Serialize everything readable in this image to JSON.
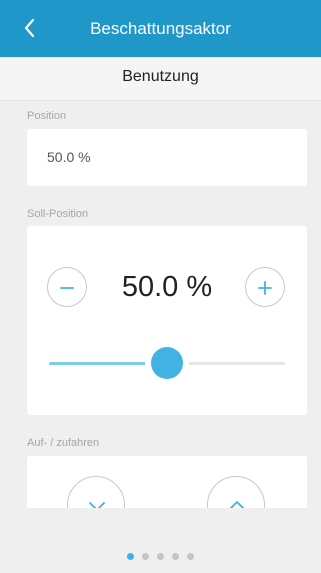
{
  "header": {
    "title": "Beschattungsaktor",
    "back_icon": "chevron-left-icon"
  },
  "subheader": {
    "title": "Benutzung"
  },
  "position": {
    "label": "Position",
    "value": "50.0 %"
  },
  "soll_position": {
    "label": "Soll-Position",
    "value": "50.0 %",
    "slider_level": 0.5,
    "minus_icon": "minus-icon",
    "plus_icon": "plus-icon"
  },
  "auf_zufahren": {
    "label": "Auf- / zufahren",
    "down_icon": "chevron-down-icon",
    "up_icon": "chevron-up-icon"
  },
  "pagination": {
    "page_count": 5,
    "active_index": 0
  },
  "colors": {
    "accent": "#1f97c9",
    "slider_thumb": "#41b2e2",
    "slider_fill": "#7fcbe9",
    "background": "#efefef"
  }
}
